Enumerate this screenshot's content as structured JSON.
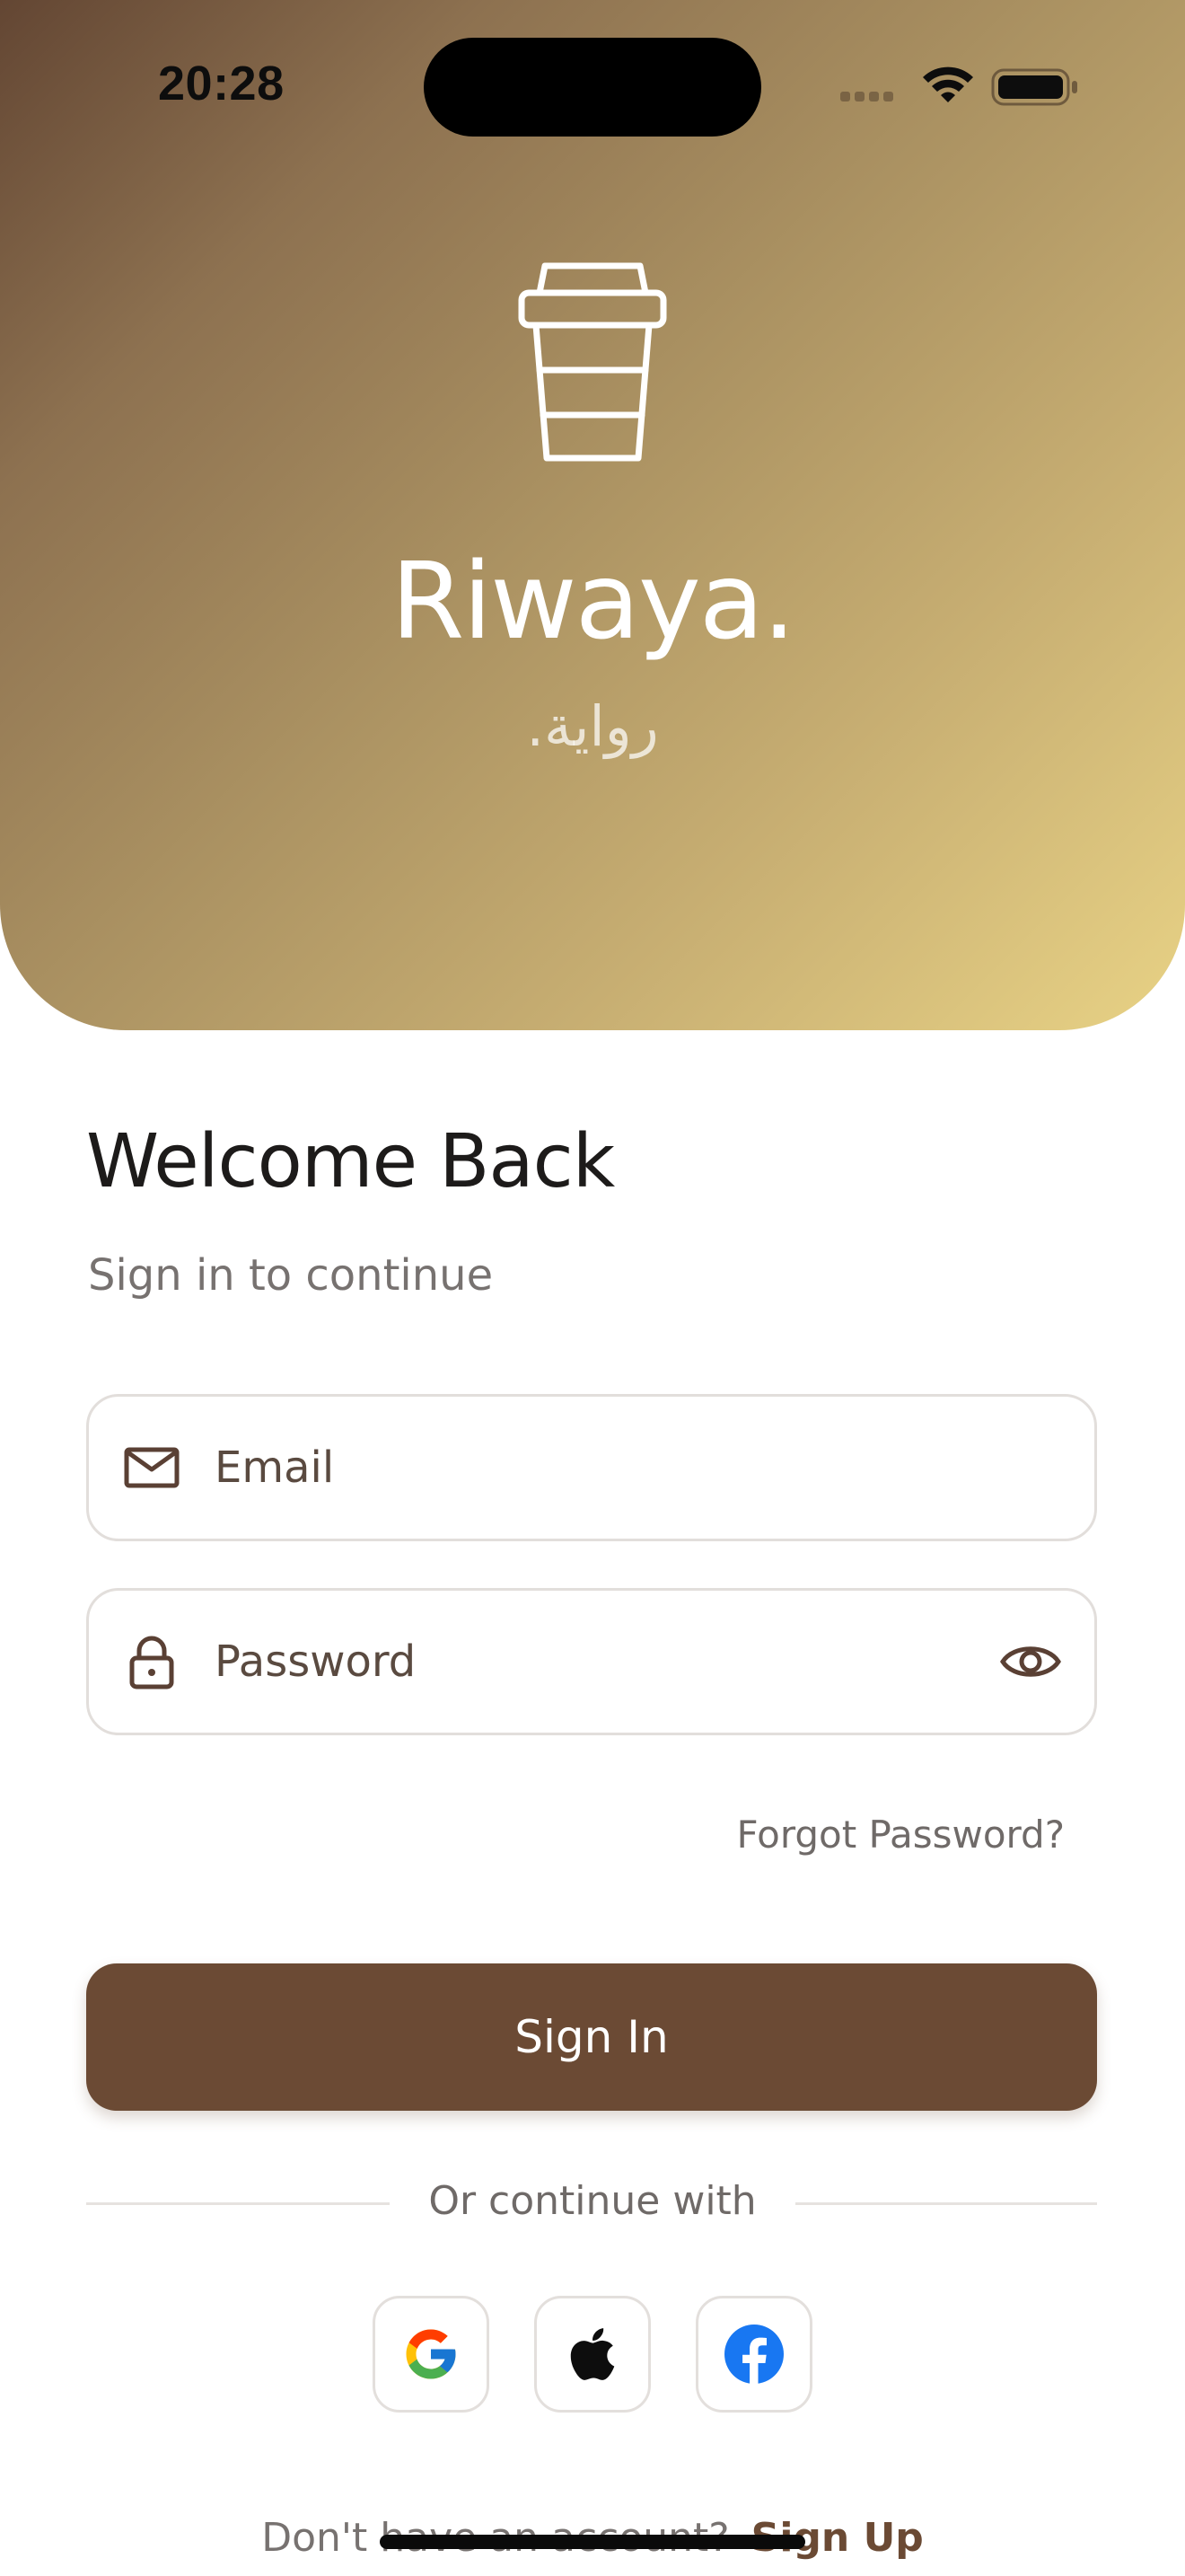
{
  "status_bar": {
    "time": "20:28"
  },
  "brand": {
    "logo_icon": "coffee-cup-icon",
    "name": "Riwaya.",
    "name_arabic": "رواية.",
    "gradient_start": "#634633",
    "gradient_end": "#e8d285"
  },
  "welcome": {
    "title": "Welcome Back",
    "subtitle": "Sign in to continue"
  },
  "form": {
    "email": {
      "icon": "mail-icon",
      "placeholder": "Email",
      "value": ""
    },
    "password": {
      "icon": "lock-icon",
      "placeholder": "Password",
      "value": "",
      "toggle_icon": "eye-icon"
    },
    "forgot_label": "Forgot Password?",
    "submit_label": "Sign In"
  },
  "social": {
    "divider_label": "Or continue with",
    "providers": [
      {
        "name": "google",
        "icon": "google-icon"
      },
      {
        "name": "apple",
        "icon": "apple-icon"
      },
      {
        "name": "facebook",
        "icon": "facebook-icon"
      }
    ]
  },
  "signup": {
    "prompt": "Don't have an account?",
    "link_label": "Sign Up"
  },
  "colors": {
    "primary": "#6b4a34",
    "text_dark": "#1d1b1a",
    "text_muted": "#777270",
    "border": "#e2dedb"
  }
}
